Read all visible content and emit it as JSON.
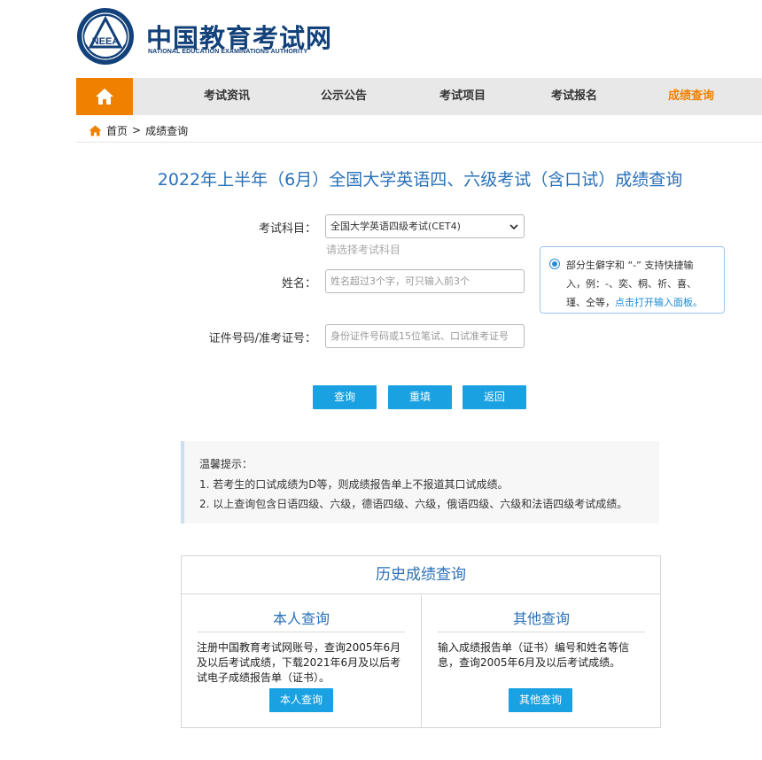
{
  "header": {
    "logo_cn": "中国教育考试网",
    "logo_en": "NATIONAL EDUCATION EXAMINATIONS AUTHORITY",
    "emblem_text": "NEEA"
  },
  "nav": {
    "home_icon": "home-icon",
    "items": [
      {
        "label": "考试资讯"
      },
      {
        "label": "公示公告"
      },
      {
        "label": "考试项目"
      },
      {
        "label": "考试报名"
      },
      {
        "label": "成绩查询"
      }
    ],
    "active_color": "#f08100"
  },
  "breadcrumb": {
    "home": "首页",
    "separator": ">",
    "current": "成绩查询"
  },
  "page_title": "2022年上半年（6月）全国大学英语四、六级考试（含口试）成绩查询",
  "form": {
    "subject_label": "考试科目：",
    "subject_value": "全国大学英语四级考试(CET4)",
    "subject_hint": "请选择考试科目",
    "name_label": "姓名：",
    "name_placeholder": "姓名超过3个字，可只输入前3个",
    "id_label": "证件号码/准考证号：",
    "id_placeholder": "身份证件号码或15位笔试、口试准考证号"
  },
  "tip": {
    "line1": "部分生僻字和 “-” 支持快捷输",
    "line2": "入，例：-、奕、桐、祈、喜、",
    "line3_prefix": "瑾、仝等，",
    "line3_link": "点击打开输入面板。"
  },
  "buttons": {
    "query": "查询",
    "reset": "重填",
    "back": "返回"
  },
  "notice": {
    "title": "温馨提示：",
    "items": [
      "1. 若考生的口试成绩为D等，则成绩报告单上不报道其口试成绩。",
      "2. 以上查询包含日语四级、六级，德语四级、六级，俄语四级、六级和法语四级考试成绩。"
    ]
  },
  "history": {
    "title": "历史成绩查询",
    "self": {
      "title": "本人查询",
      "desc": [
        "注册中国教育考试网账号，查询2005年6月",
        "及以后考试成绩，下载2021年6月及以后考",
        "试电子成绩报告单（证书）。"
      ],
      "button": "本人查询"
    },
    "other": {
      "title": "其他查询",
      "desc": [
        "输入成绩报告单（证书）编号和姓名等信",
        "息，查询2005年6月及以后考试成绩。"
      ],
      "button": "其他查询"
    }
  }
}
